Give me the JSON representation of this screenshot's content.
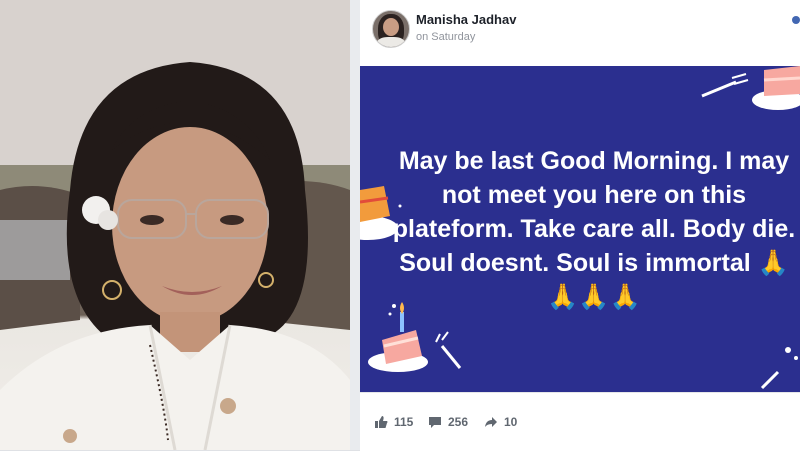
{
  "post": {
    "author": "Manisha Jadhav",
    "timestamp": "on Saturday",
    "message": "May be last Good Morning. I may not meet you here on this plateform. Take care all. Body die. Soul doesnt. Soul is immortal 🙏🙏🙏🙏",
    "likes": "115",
    "comments": "256",
    "shares": "10"
  },
  "colors": {
    "banner": "#2b2f8f",
    "text": "#ffffff"
  },
  "icons": [
    "like-icon",
    "comment-icon",
    "share-icon",
    "more-icon",
    "cake-icon",
    "fork-icon"
  ]
}
